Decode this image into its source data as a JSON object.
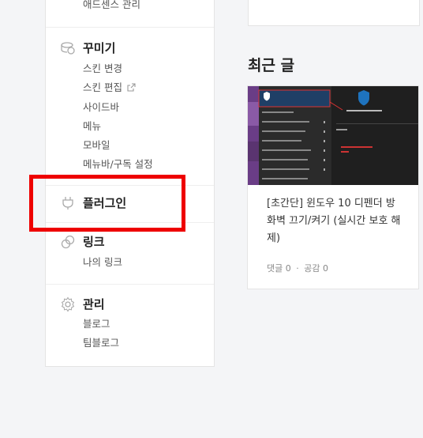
{
  "sidebar": {
    "adsense_manage": "애드센스 관리",
    "decorate": {
      "title": "꾸미기",
      "items": [
        "스킨 변경",
        "스킨 편집",
        "사이드바",
        "메뉴",
        "모바일",
        "메뉴바/구독 설정"
      ]
    },
    "plugin": {
      "title": "플러그인"
    },
    "link": {
      "title": "링크",
      "items": [
        "나의 링크"
      ]
    },
    "manage": {
      "title": "관리",
      "items": [
        "블로그",
        "팀블로그"
      ]
    }
  },
  "recent": {
    "heading": "최근 글",
    "post": {
      "title": "[초간단] 윈도우 10 디펜더 방화벽 끄기/켜기 (실시간 보호 해제)",
      "comments": "댓글 0",
      "likes": "공감 0"
    }
  },
  "colors": {
    "highlight_red": "#ee0000",
    "accent_blue": "#1e73be"
  }
}
